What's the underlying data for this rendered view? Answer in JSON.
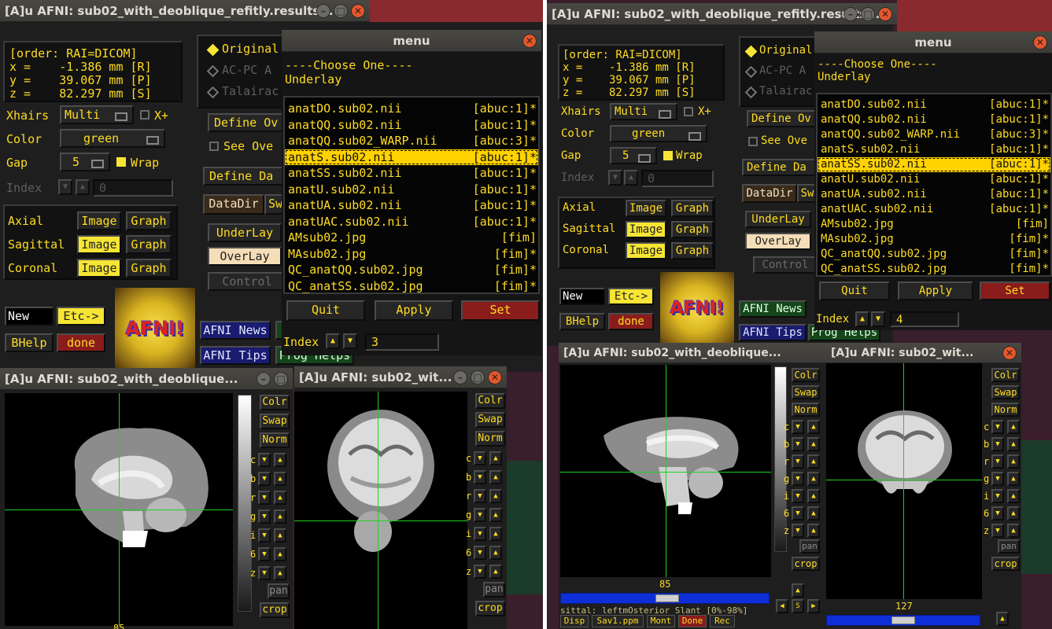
{
  "left": {
    "main_title": "[A]u AFNI: sub02_with_deoblique_refitly.results...",
    "coords": {
      "order": "[order: RAI=DICOM]",
      "x": "x =    -1.386 mm [R]",
      "y": "y =    39.067 mm [P]",
      "z": "z =    82.297 mm [S]"
    },
    "xhairs_label": "Xhairs",
    "xhairs_value": "Multi",
    "xplus_label": "X+",
    "color_label": "Color",
    "color_value": "green",
    "gap_label": "Gap",
    "gap_value": "5",
    "wrap_label": "Wrap",
    "index_label": "Index",
    "index_value": "0",
    "axial_label": "Axial",
    "sagittal_label": "Sagittal",
    "coronal_label": "Coronal",
    "image_label": "Image",
    "graph_label": "Graph",
    "view_original": "Original",
    "view_acpc": "AC-PC A",
    "view_talairach": "Talairac",
    "define_overlay": "Define Ov",
    "see_overlay": "See Ove",
    "define_datamode": "Define Da",
    "datadir": "DataDir",
    "datadir_sw": "Sw",
    "underlay": "UnderLay",
    "overlay": "OverLay",
    "control": "Control",
    "new": "New",
    "etc": "Etc->",
    "bhelp": "BHelp",
    "done": "done",
    "afni_news": "AFNI News",
    "afni_tips": "AFNI Tips",
    "prog_helps": "Prog Helps",
    "logo_text": "AFNI!",
    "menu": {
      "title": "menu",
      "choose": "----Choose One----",
      "subtitle": "Underlay",
      "items": [
        {
          "name": "anatDO.sub02.nii",
          "tag": "[abuc:1]*"
        },
        {
          "name": "anatQQ.sub02.nii",
          "tag": "[abuc:1]*"
        },
        {
          "name": "anatQQ.sub02_WARP.nii",
          "tag": "[abuc:3]*"
        },
        {
          "name": "anatS.sub02.nii",
          "tag": "[abuc:1]*"
        },
        {
          "name": "anatSS.sub02.nii",
          "tag": "[abuc:1]*"
        },
        {
          "name": "anatU.sub02.nii",
          "tag": "[abuc:1]*"
        },
        {
          "name": "anatUA.sub02.nii",
          "tag": "[abuc:1]*"
        },
        {
          "name": "anatUAC.sub02.nii",
          "tag": "[abuc:1]*"
        },
        {
          "name": "AMsub02.jpg",
          "tag": "[fim]"
        },
        {
          "name": "MAsub02.jpg",
          "tag": "[fim]*"
        },
        {
          "name": "QC_anatQQ.sub02.jpg",
          "tag": "[fim]*"
        },
        {
          "name": "QC_anatSS.sub02.jpg",
          "tag": "[fim]*"
        }
      ],
      "quit": "Quit",
      "apply": "Apply",
      "set": "Set",
      "index_label": "Index",
      "index_value": "3"
    },
    "sag_title": "[A]u AFNI: sub02_with_deoblique...",
    "cor_title": "[A]u AFNI: sub02_wit...",
    "sag_slice": "85"
  },
  "right": {
    "main_title": "[A]u AFNI: sub02_with_deoblique_refitly.results...",
    "menu": {
      "title": "menu",
      "choose": "----Choose One----",
      "subtitle": "Underlay",
      "items": [
        {
          "name": "anatDO.sub02.nii",
          "tag": "[abuc:1]*"
        },
        {
          "name": "anatQQ.sub02.nii",
          "tag": "[abuc:1]*"
        },
        {
          "name": "anatQQ.sub02_WARP.nii",
          "tag": "[abuc:3]*"
        },
        {
          "name": "anatS.sub02.nii",
          "tag": "[abuc:1]*"
        },
        {
          "name": "anatSS.sub02.nii",
          "tag": "[abuc:1]*"
        },
        {
          "name": "anatU.sub02.nii",
          "tag": "[abuc:1]*"
        },
        {
          "name": "anatUA.sub02.nii",
          "tag": "[abuc:1]*"
        },
        {
          "name": "anatUAC.sub02.nii",
          "tag": "[abuc:1]*"
        },
        {
          "name": "AMsub02.jpg",
          "tag": "[fim]"
        },
        {
          "name": "MAsub02.jpg",
          "tag": "[fim]*"
        },
        {
          "name": "QC_anatQQ.sub02.jpg",
          "tag": "[fim]*"
        },
        {
          "name": "QC_anatSS.sub02.jpg",
          "tag": "[fim]*"
        }
      ],
      "quit": "Quit",
      "apply": "Apply",
      "set": "Set",
      "index_label": "Index",
      "index_value": "4"
    },
    "sag_title": "[A]u AFNI: sub02_with_deoblique...",
    "cor_title": "[A]u AFNI: sub02_wit...",
    "sag_slice": "85",
    "cor_slice": "127",
    "status_text": "sittal: leftmOsterior Slant [0%-98%]",
    "bottom_tabs": [
      "Disp",
      "Sav1.ppm",
      "Mont",
      "Done",
      "Rec"
    ]
  },
  "viewer_buttons": {
    "colr": "Colr",
    "swap": "Swap",
    "norm": "Norm",
    "pan": "pan",
    "crop": "crop",
    "row_labels": [
      "c",
      "b",
      "r",
      "g",
      "i",
      "6",
      "z"
    ]
  },
  "colors": {
    "accent_yellow": "#ffdd22",
    "selected_bg": "#ffd200",
    "crosshair": "#1fd21f",
    "done_red": "#8a1c1c"
  }
}
